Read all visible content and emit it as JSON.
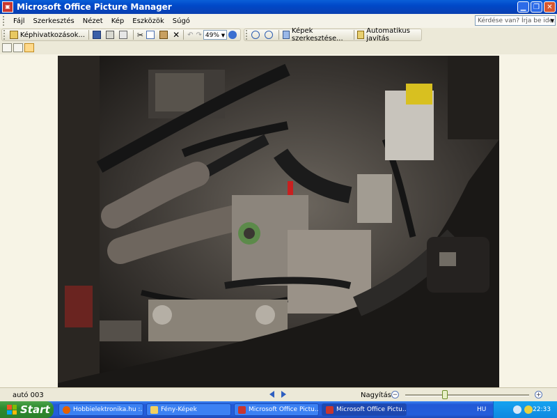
{
  "window": {
    "title": "Microsoft Office Picture Manager",
    "app_icon": "picture-manager-icon"
  },
  "menu": {
    "items": [
      "Fájl",
      "Szerkesztés",
      "Nézet",
      "Kép",
      "Eszközök",
      "Súgó"
    ],
    "help_placeholder": "Kérdése van? Írja be ide."
  },
  "toolbar": {
    "shortcuts_label": "Képhivatkozások...",
    "zoom_value": "49%",
    "edit_pictures_label": "Képek szerkesztése...",
    "auto_correct_label": "Automatikus javítás"
  },
  "status": {
    "filename": "autó 003",
    "zoom_label": "Nagyítás:",
    "zoom_slider_position": 0.32
  },
  "taskbar": {
    "start_label": "Start",
    "tasks": [
      {
        "label": "Hobbielektronika.hu :...",
        "icon": "firefox-icon"
      },
      {
        "label": "Fény-Képek",
        "icon": "folder-icon"
      },
      {
        "label": "Microsoft Office Pictu...",
        "icon": "picture-manager-icon"
      },
      {
        "label": "Microsoft Office Pictu...",
        "icon": "picture-manager-icon"
      }
    ],
    "language": "HU",
    "clock": "22:33"
  },
  "colors": {
    "titlebar": "#0A5FD8",
    "taskbar": "#245EDB",
    "start": "#2E8B2E",
    "tray": "#0F88E0"
  }
}
